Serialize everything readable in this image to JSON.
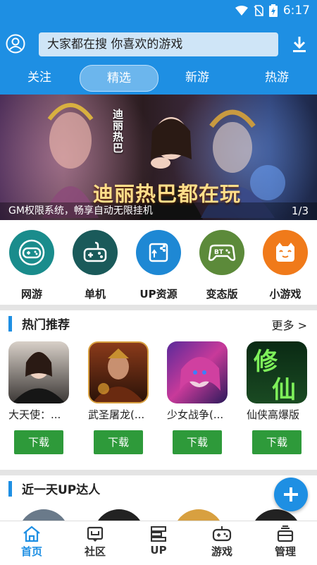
{
  "statusbar": {
    "time": "6:17"
  },
  "header": {
    "search_placeholder": "大家都在搜  你喜欢的游戏",
    "icons": [
      "user-icon",
      "download-icon"
    ]
  },
  "tabs": [
    {
      "label": "关注",
      "active": false
    },
    {
      "label": "精选",
      "active": true
    },
    {
      "label": "新游",
      "active": false
    },
    {
      "label": "热游",
      "active": false
    }
  ],
  "banner": {
    "headline": "迪丽热巴都在玩",
    "vertical_text": "迪丽热巴",
    "caption": "GM权限系统，畅享自动无限挂机",
    "page_indicator": "1/3"
  },
  "categories": [
    {
      "label": "网游",
      "color": "#1a8c8c",
      "icon": "gamepad-icon"
    },
    {
      "label": "单机",
      "color": "#1a5a5a",
      "icon": "joystick-icon"
    },
    {
      "label": "UP资源",
      "color": "#1e88d4",
      "icon": "share-upload-icon"
    },
    {
      "label": "变态版",
      "color": "#5c8a3a",
      "icon": "bt-controller-icon"
    },
    {
      "label": "小游戏",
      "color": "#f07a1a",
      "icon": "cat-face-icon"
    }
  ],
  "hot": {
    "title": "热门推荐",
    "more": "更多 >",
    "games": [
      {
        "name": "大天使：...",
        "button": "下载"
      },
      {
        "name": "武圣屠龙(...",
        "button": "下载"
      },
      {
        "name": "少女战争(...",
        "button": "下载"
      },
      {
        "name": "仙侠高爆版",
        "button": "下载"
      }
    ]
  },
  "up": {
    "title": "近一天UP达人"
  },
  "bottom_nav": [
    {
      "label": "首页",
      "icon": "home-icon",
      "active": true
    },
    {
      "label": "社区",
      "icon": "community-icon",
      "active": false
    },
    {
      "label": "UP",
      "icon": "up-icon",
      "active": false
    },
    {
      "label": "游戏",
      "icon": "gamepad-icon",
      "active": false
    },
    {
      "label": "管理",
      "icon": "manage-icon",
      "active": false
    }
  ],
  "colors": {
    "primary": "#1e8fe3",
    "download_green": "#2e9a3a"
  }
}
